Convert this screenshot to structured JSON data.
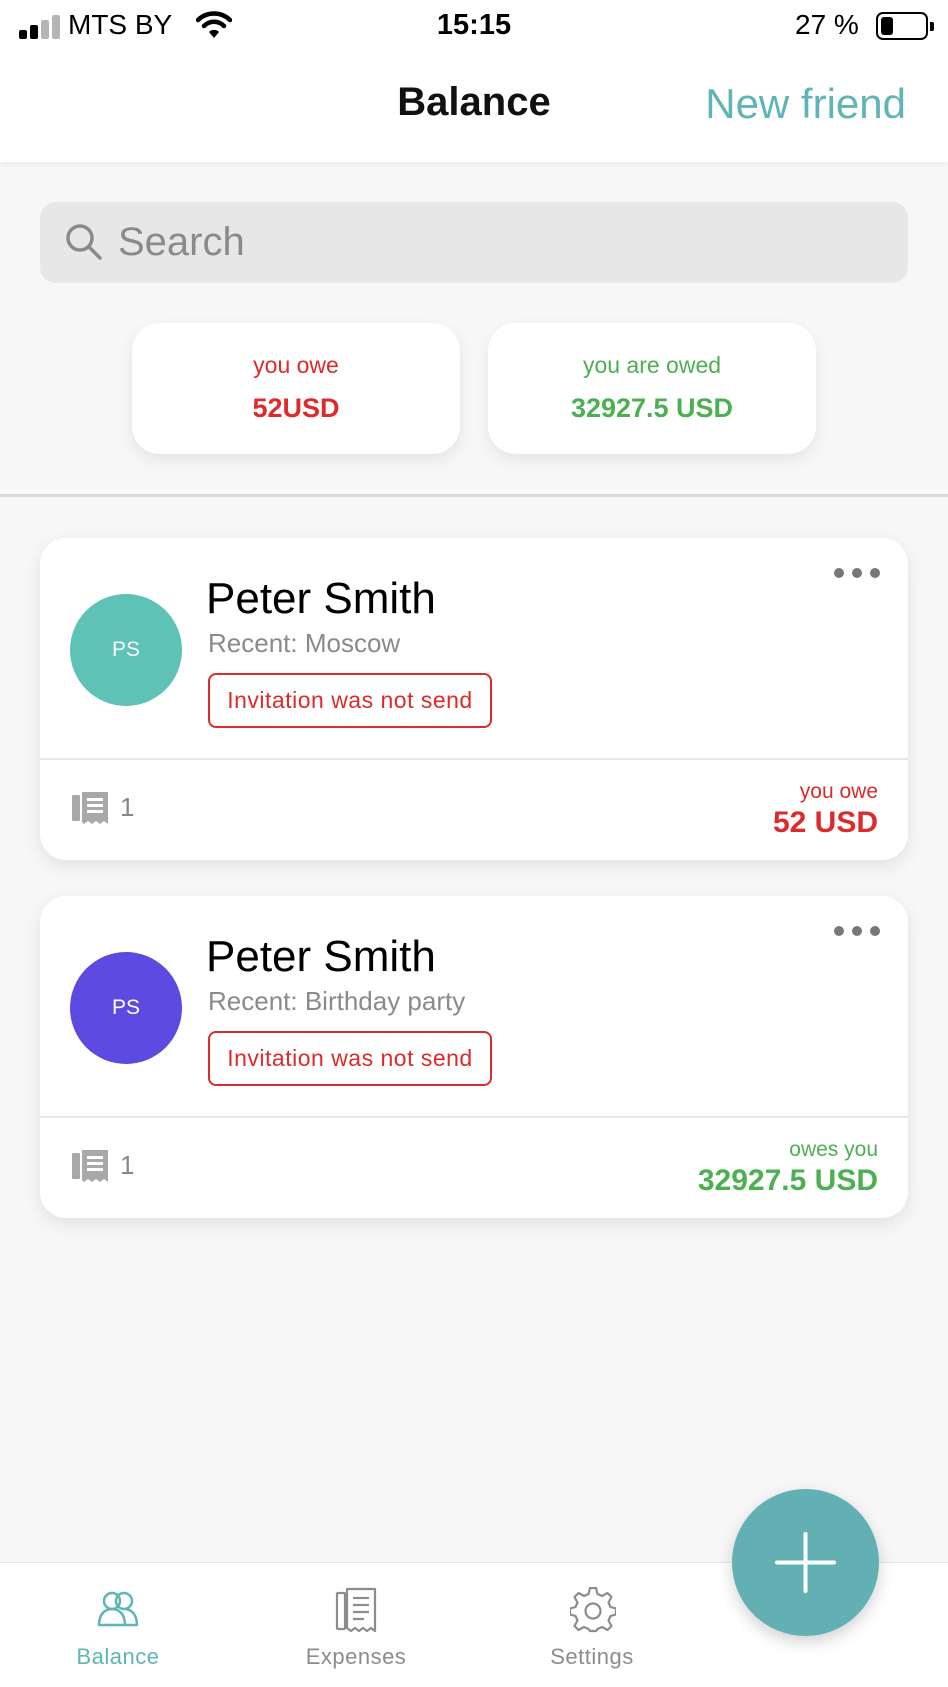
{
  "status_bar": {
    "carrier": "MTS BY",
    "time": "15:15",
    "battery": "27 %"
  },
  "header": {
    "title": "Balance",
    "new_friend_label": "New friend"
  },
  "search": {
    "placeholder": "Search",
    "value": ""
  },
  "summary": {
    "you_owe_label": "you owe",
    "you_owe_amount": "52USD",
    "you_are_owed_label": "you are owed",
    "you_are_owed_amount": "32927.5 USD"
  },
  "friends": [
    {
      "initials": "PS",
      "avatar_color": "#5ec2b6",
      "name": "Peter Smith",
      "recent": "Recent: Moscow",
      "invite_status": "Invitation was not send",
      "expense_count": "1",
      "balance_label": "you owe",
      "balance_amount": "52 USD",
      "balance_color": "#dd2a2a"
    },
    {
      "initials": "PS",
      "avatar_color": "#5d4ae0",
      "name": "Peter Smith",
      "recent": "Recent: Birthday party",
      "invite_status": "Invitation was not send",
      "expense_count": "1",
      "balance_label": "owes you",
      "balance_amount": "32927.5 USD",
      "balance_color": "#4caf50"
    }
  ],
  "tabbar": {
    "balance_label": "Balance",
    "expenses_label": "Expenses",
    "settings_label": "Settings",
    "active_color": "#5fb5b6"
  },
  "icons": {
    "search": "search-icon",
    "more": "more-icon",
    "receipt": "receipt-icon",
    "balance_tab": "friends-icon",
    "expenses_tab": "expenses-icon",
    "settings_tab": "gear-icon",
    "fab": "plus-icon"
  }
}
